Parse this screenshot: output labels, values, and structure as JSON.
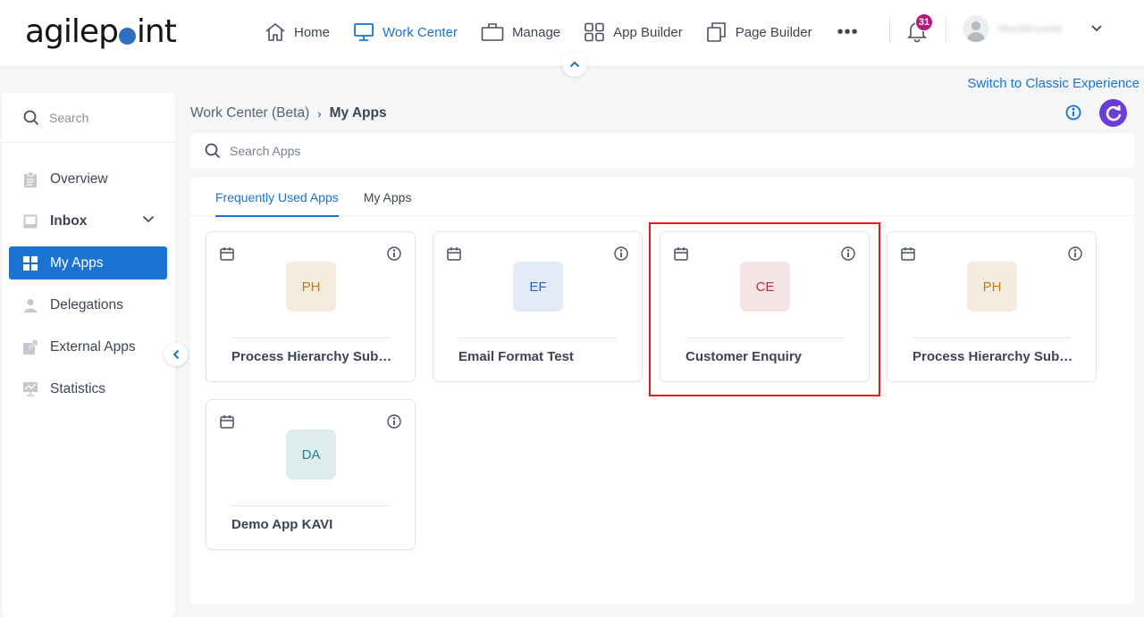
{
  "header": {
    "logo_left": "agilep",
    "logo_right": "int",
    "nav": [
      {
        "label": "Home",
        "icon": "home-icon",
        "active": false
      },
      {
        "label": "Work Center",
        "icon": "monitor-icon",
        "active": true
      },
      {
        "label": "Manage",
        "icon": "briefcase-icon",
        "active": false
      },
      {
        "label": "App Builder",
        "icon": "grid-icon",
        "active": false
      },
      {
        "label": "Page Builder",
        "icon": "pages-icon",
        "active": false
      }
    ],
    "more_label": "•••",
    "notification_count": "31",
    "username": "MuraliGowda"
  },
  "classic_link": "Switch to Classic Experience",
  "sidebar": {
    "search_placeholder": "Search",
    "items": [
      {
        "label": "Overview",
        "icon": "clipboard-icon",
        "active": false
      },
      {
        "label": "Inbox",
        "icon": "inbox-icon",
        "active": false,
        "expandable": true
      },
      {
        "label": "My Apps",
        "icon": "apps-grid-icon",
        "active": true
      },
      {
        "label": "Delegations",
        "icon": "person-icon",
        "active": false
      },
      {
        "label": "External Apps",
        "icon": "external-link-icon",
        "active": false
      },
      {
        "label": "Statistics",
        "icon": "chart-monitor-icon",
        "active": false
      }
    ]
  },
  "breadcrumb": {
    "parent": "Work Center (Beta)",
    "separator": "›",
    "current": "My Apps"
  },
  "search_apps": {
    "placeholder": "Search Apps",
    "value": ""
  },
  "tabs": [
    {
      "label": "Frequently Used Apps",
      "active": true
    },
    {
      "label": "My Apps",
      "active": false
    }
  ],
  "apps": [
    {
      "initials": "PH",
      "name": "Process Hierarchy Subpr...",
      "tile_bg": "#f6ecdd",
      "tile_fg": "#c07a1f"
    },
    {
      "initials": "EF",
      "name": "Email Format Test",
      "tile_bg": "#e4ebf6",
      "tile_fg": "#2f62c4"
    },
    {
      "initials": "CE",
      "name": "Customer Enquiry",
      "tile_bg": "#f5e4e4",
      "tile_fg": "#b3303a",
      "highlighted": true
    },
    {
      "initials": "PH",
      "name": "Process Hierarchy Subpr...",
      "tile_bg": "#f6ecdd",
      "tile_fg": "#c07a1f"
    },
    {
      "initials": "DA",
      "name": "Demo App KAVI",
      "tile_bg": "#deeced",
      "tile_fg": "#1f7f8a"
    }
  ],
  "colors": {
    "accent": "#1a73d1",
    "refresh_button": "#6a3ed6",
    "badge": "#b5197a",
    "highlight_border": "#e01b1b"
  }
}
